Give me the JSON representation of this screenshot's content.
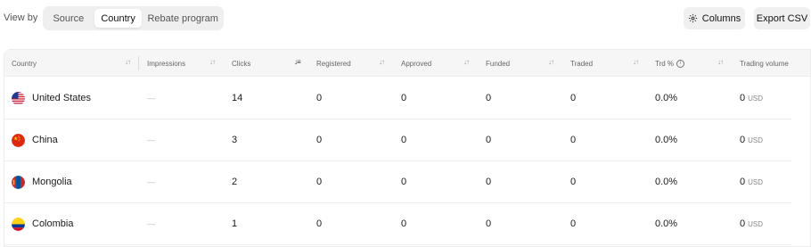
{
  "toolbar": {
    "view_by_label": "View by",
    "segments": [
      "Source",
      "Country",
      "Rebate program"
    ],
    "selected_segment": "Country",
    "columns_label": "Columns",
    "export_label": "Export CSV"
  },
  "table": {
    "headers": [
      "Country",
      "Impressions",
      "Clicks",
      "Registered",
      "Approved",
      "Funded",
      "Traded",
      "Trd %",
      "Trading volume"
    ],
    "active_sort_column": "Clicks",
    "rows": [
      {
        "country": "United States",
        "impressions": "—",
        "clicks": "14",
        "registered": "0",
        "approved": "0",
        "funded": "0",
        "traded": "0",
        "trd_pct": "0.0%",
        "volume": "0",
        "volume_unit": "USD"
      },
      {
        "country": "China",
        "impressions": "—",
        "clicks": "3",
        "registered": "0",
        "approved": "0",
        "funded": "0",
        "traded": "0",
        "trd_pct": "0.0%",
        "volume": "0",
        "volume_unit": "USD"
      },
      {
        "country": "Mongolia",
        "impressions": "—",
        "clicks": "2",
        "registered": "0",
        "approved": "0",
        "funded": "0",
        "traded": "0",
        "trd_pct": "0.0%",
        "volume": "0",
        "volume_unit": "USD"
      },
      {
        "country": "Colombia",
        "impressions": "—",
        "clicks": "1",
        "registered": "0",
        "approved": "0",
        "funded": "0",
        "traded": "0",
        "trd_pct": "0.0%",
        "volume": "0",
        "volume_unit": "USD"
      }
    ]
  },
  "icons": {
    "sort": "sort-arrows-icon",
    "gear": "gear-icon",
    "info": "info-icon"
  }
}
